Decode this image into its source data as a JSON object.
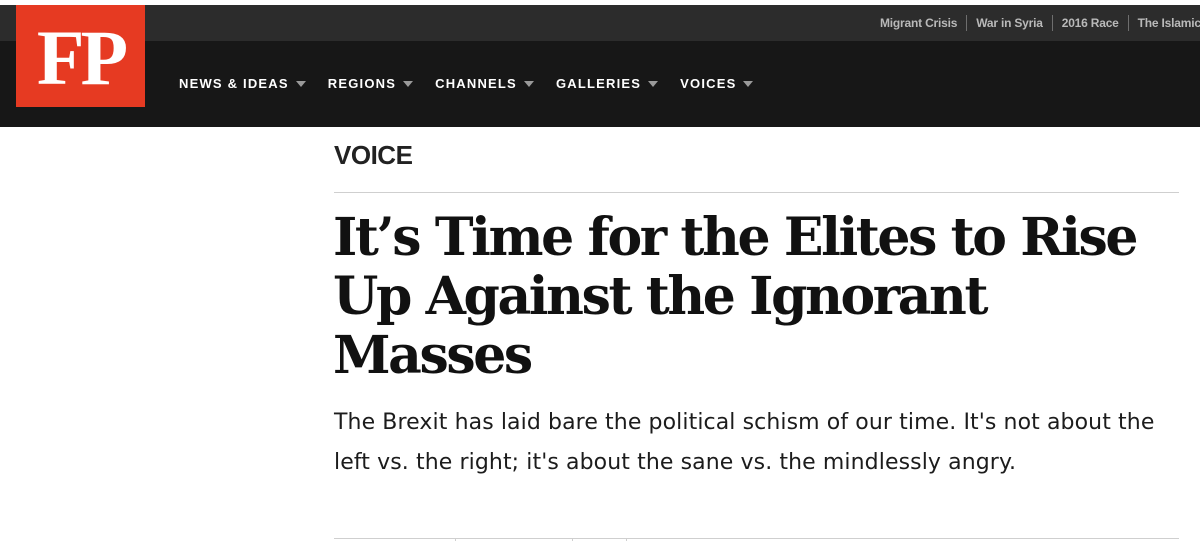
{
  "header": {
    "logo_text": "FP",
    "utility_links": [
      "Migrant Crisis",
      "War in Syria",
      "2016 Race",
      "The Islamic State"
    ],
    "nav": [
      {
        "label": "NEWS & IDEAS"
      },
      {
        "label": "REGIONS"
      },
      {
        "label": "CHANNELS"
      },
      {
        "label": "GALLERIES"
      },
      {
        "label": "VOICES"
      }
    ]
  },
  "article": {
    "kicker": "VOICE",
    "headline": "It’s Time for the Elites to Rise Up Against the Ignorant Masses",
    "dek": "The Brexit has laid bare the political schism of our time. It's not about the left vs. the right; it's about the sane vs. the mindlessly angry."
  },
  "colors": {
    "brand_red": "#e63a22",
    "header_bg": "#171717",
    "utility_bar_bg": "#2c2c2c"
  },
  "icons": {
    "nav_caret": "caret-down-icon"
  }
}
